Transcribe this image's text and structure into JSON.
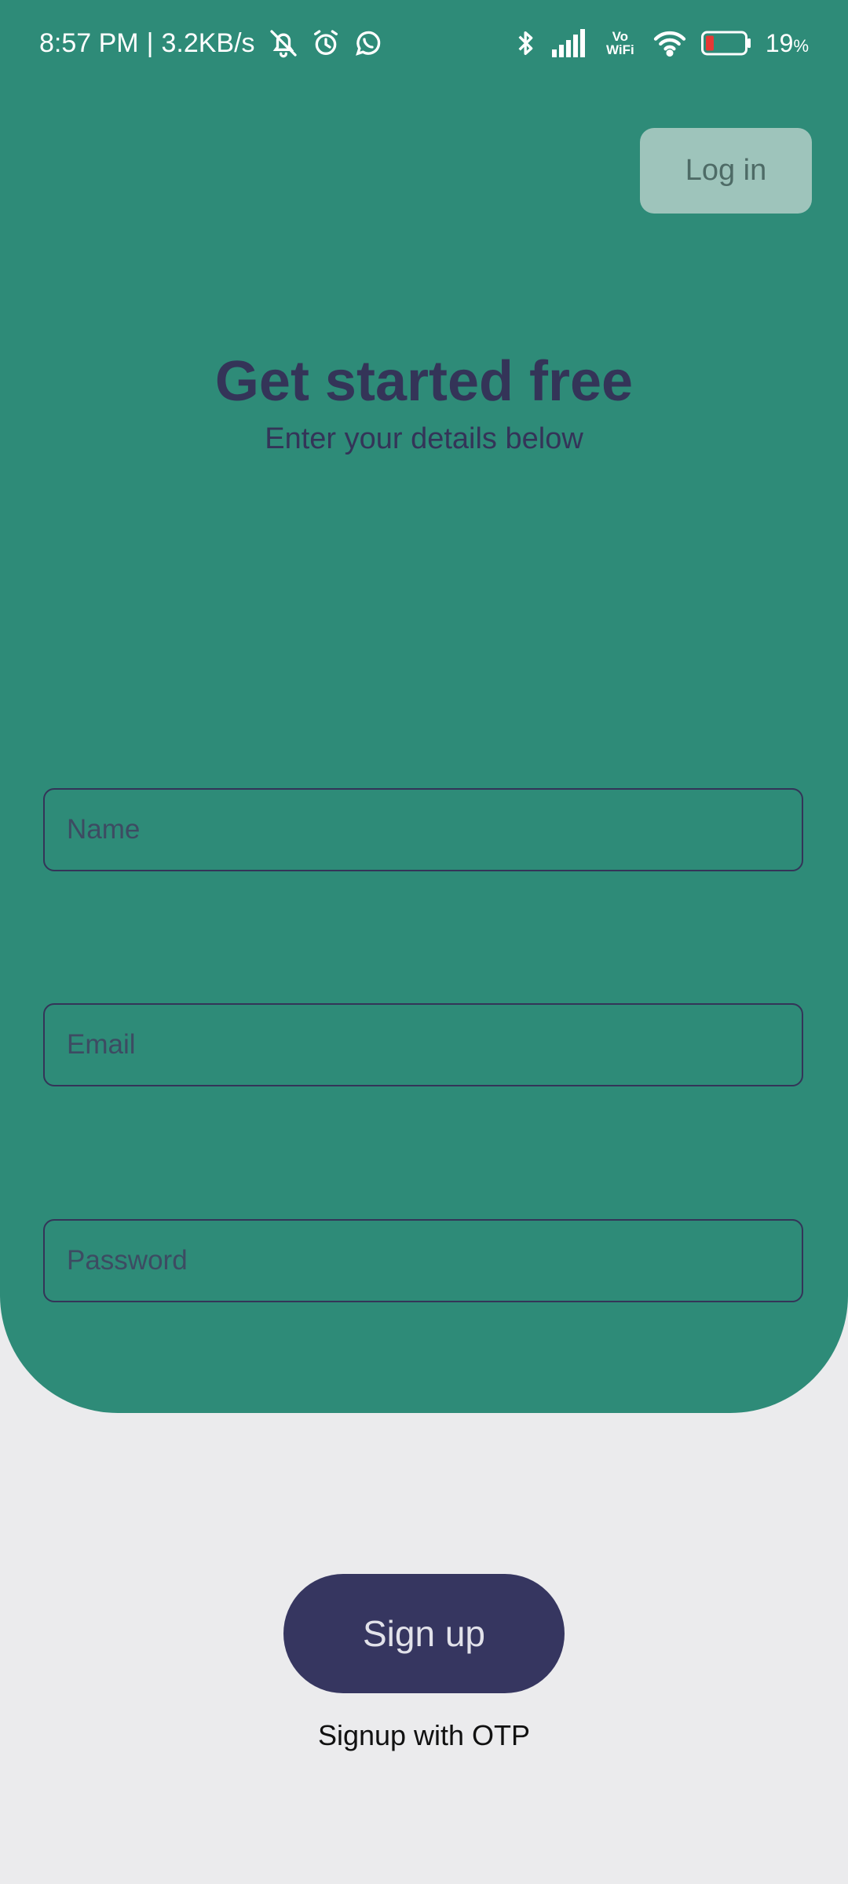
{
  "status_bar": {
    "time": "8:57 PM",
    "separator": "|",
    "net_speed": "3.2KB/s",
    "vowifi_top": "Vo",
    "vowifi_bottom": "WiFi",
    "battery_percent": "19",
    "battery_unit": "%",
    "battery_level": 0.19,
    "icons": [
      "muted-bell-icon",
      "alarm-icon",
      "whatsapp-icon",
      "bluetooth-icon",
      "signal-icon",
      "vowifi-icon",
      "wifi-icon",
      "battery-icon"
    ]
  },
  "header": {
    "login_label": "Log in"
  },
  "hero": {
    "title": "Get started free",
    "subtitle": "Enter your details below"
  },
  "form": {
    "name_placeholder": "Name",
    "name_value": "",
    "email_placeholder": "Email",
    "email_value": "",
    "password_placeholder": "Password",
    "password_value": ""
  },
  "actions": {
    "signup_label": "Sign up",
    "otp_label": "Signup with OTP"
  },
  "colors": {
    "panel": "#2e8b78",
    "background": "#ebebed",
    "primary_dark": "#363660",
    "text_dark": "#343458",
    "login_bg": "#9ec4bb",
    "battery_low": "#e53935"
  }
}
